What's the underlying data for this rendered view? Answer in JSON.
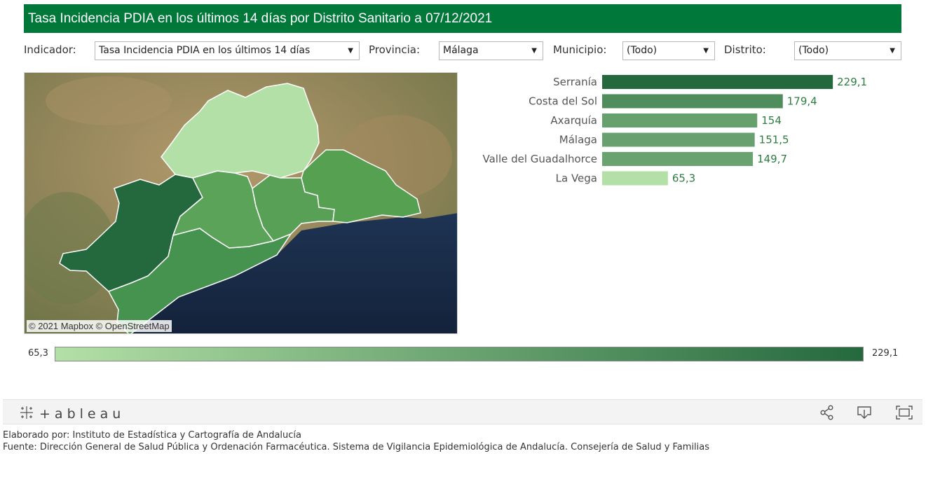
{
  "title": "Tasa Incidencia PDIA en los últimos 14 días por Distrito Sanitario a 07/12/2021",
  "filters": {
    "indicador": {
      "label": "Indicador:",
      "value": "Tasa Incidencia PDIA en los últimos 14 días"
    },
    "provincia": {
      "label": "Provincia:",
      "value": "Málaga"
    },
    "municipio": {
      "label": "Municipio:",
      "value": "(Todo)"
    },
    "distrito": {
      "label": "Distrito:",
      "value": "(Todo)"
    }
  },
  "map": {
    "attribution": "© 2021 Mapbox  © OpenStreetMap"
  },
  "chart_data": {
    "type": "bar",
    "orientation": "horizontal",
    "categories": [
      "Serranía",
      "Costa del Sol",
      "Axarquía",
      "Málaga",
      "Valle del Guadalhorce",
      "La Vega"
    ],
    "values": [
      229.1,
      179.4,
      154,
      151.5,
      149.7,
      65.3
    ],
    "value_labels": [
      "229,1",
      "179,4",
      "154",
      "151,5",
      "149,7",
      "65,3"
    ],
    "title": "",
    "xlabel": "",
    "ylabel": "",
    "xlim": [
      0,
      245
    ],
    "color_scale": {
      "min_color": "#b3e0a6",
      "max_color": "#24693d"
    }
  },
  "legend": {
    "min_label": "65,3",
    "max_label": "229,1",
    "min_color": "#b3e0a6",
    "max_color": "#24693d"
  },
  "toolbar": {
    "logo_text": "+ableau",
    "share_icon": "share-icon",
    "download_icon": "download-icon",
    "fullscreen_icon": "fullscreen-icon"
  },
  "footer": {
    "line1": "Elaborado por: Instituto de Estadística y Cartografía de Andalucía",
    "line2": "Fuente: Dirección General de Salud Pública y Ordenación Farmacéutica. Sistema de Vigilancia Epidemiológica de Andalucía. Consejería de Salud y Familias"
  }
}
